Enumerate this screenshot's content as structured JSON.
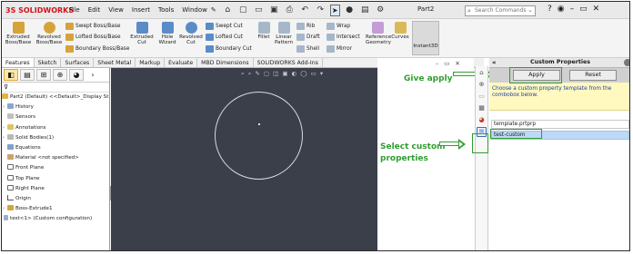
{
  "app": {
    "brand": "3S SOLIDWORKS",
    "doc_title": "Part2"
  },
  "menu": [
    "File",
    "Edit",
    "View",
    "Insert",
    "Tools",
    "Window"
  ],
  "search": {
    "placeholder": "Search Commands"
  },
  "ribbon": {
    "extruded_boss": "Extruded Boss/Base",
    "revolved_boss": "Revolved Boss/Base",
    "swept_boss": "Swept Boss/Base",
    "lofted_boss": "Lofted Boss/Base",
    "boundary_boss": "Boundary Boss/Base",
    "extruded_cut": "Extruded Cut",
    "hole_wizard": "Hole Wizard",
    "revolved_cut": "Revolved Cut",
    "swept_cut": "Swept Cut",
    "lofted_cut": "Lofted Cut",
    "boundary_cut": "Boundary Cut",
    "fillet": "Fillet",
    "linear_pattern": "Linear Pattern",
    "rib": "Rib",
    "draft": "Draft",
    "shell": "Shell",
    "wrap": "Wrap",
    "intersect": "Intersect",
    "mirror": "Mirror",
    "reference_geometry": "Reference Geometry",
    "curves": "Curves",
    "instant3d": "Instant3D"
  },
  "tabs": [
    "Features",
    "Sketch",
    "Surfaces",
    "Sheet Metal",
    "Markup",
    "Evaluate",
    "MBD Dimensions",
    "SOLIDWORKS Add-Ins"
  ],
  "tree": {
    "root": "Part2 (Default) <<Default>_Display St",
    "items": [
      "History",
      "Sensors",
      "Annotations",
      "Solid Bodies(1)",
      "Equations",
      "Material <not specified>",
      "Front Plane",
      "Top Plane",
      "Right Plane",
      "Origin",
      "Boss-Extrude1",
      "test<1> (Custom configuration)"
    ]
  },
  "annotations": {
    "give_apply": "Give apply",
    "select_custom_1": "Select custom",
    "select_custom_2": "properties"
  },
  "custom_properties": {
    "title": "Custom Properties",
    "apply_label": "Apply",
    "reset_label": "Reset",
    "message": "Choose a custom property template from the combobox below.",
    "template_value": "template.prtprp",
    "selected_item": "test-custom"
  },
  "colors": {
    "annotation_green": "#2f9e2f",
    "brand_red": "#d1121a",
    "viewport_bg": "#3a3f4a",
    "message_bg": "#fff8bf"
  }
}
